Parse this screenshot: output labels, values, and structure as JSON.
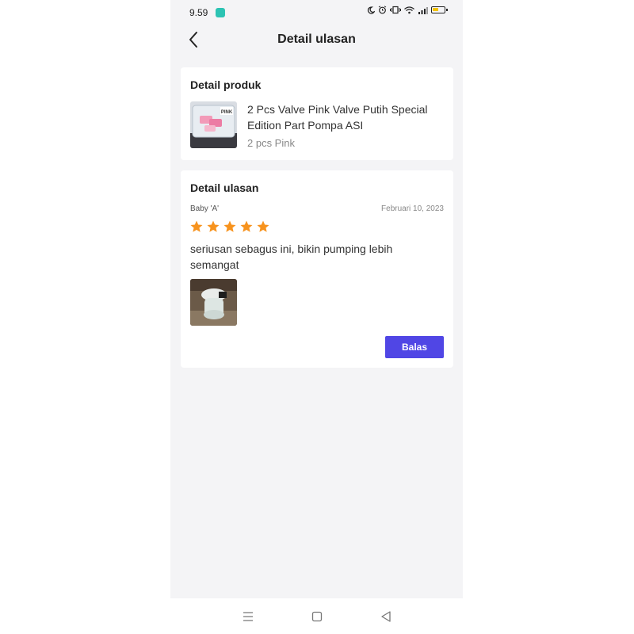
{
  "status_bar": {
    "time": "9.59",
    "icons": [
      "app-notification-icon",
      "moon-icon",
      "alarm-icon",
      "vibrate-icon",
      "wifi-icon",
      "signal-icon",
      "battery-icon"
    ]
  },
  "header": {
    "title": "Detail ulasan",
    "back_icon": "chevron-left-icon"
  },
  "product_card": {
    "title": "Detail produk",
    "product_name": "2 Pcs Valve Pink Valve Putih Special Edition Part Pompa ASI",
    "variant": "2 pcs Pink",
    "thumbnail_label": "PINK"
  },
  "review_card": {
    "title": "Detail ulasan",
    "reviewer": "Baby 'A'",
    "date": "Februari 10, 2023",
    "rating": 5,
    "rating_max": 5,
    "text": "seriusan sebagus ini, bikin pumping lebih semangat",
    "reply_button": "Balas"
  },
  "colors": {
    "star": "#f7931e",
    "button": "#5046e5",
    "background": "#f4f4f6"
  },
  "nav_bar": {
    "icons": [
      "menu-icon",
      "home-square-icon",
      "back-triangle-icon"
    ]
  }
}
